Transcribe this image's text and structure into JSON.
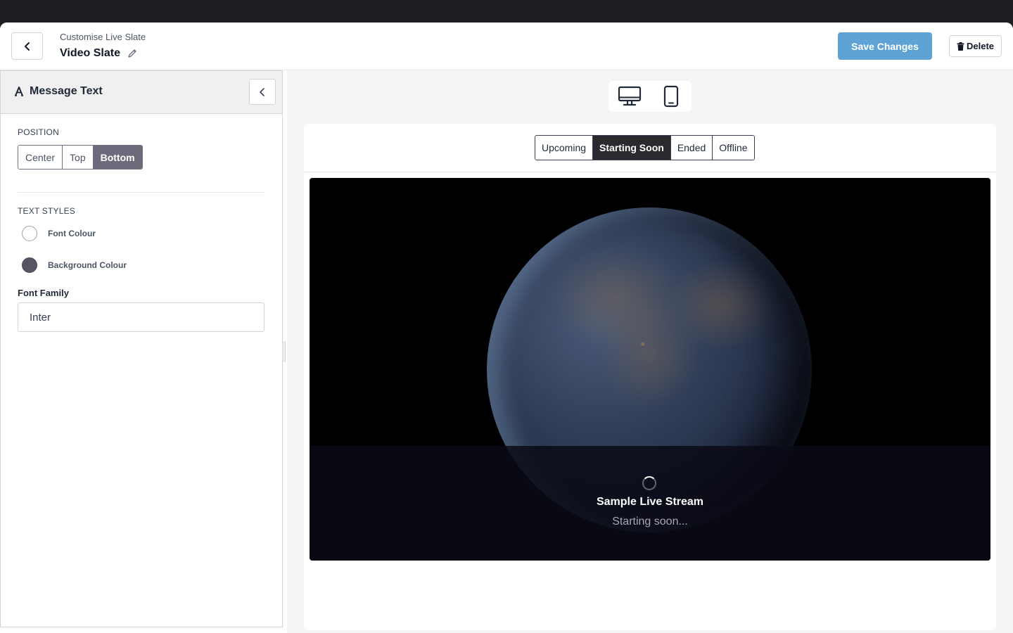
{
  "header": {
    "subtitle": "Customise Live Slate",
    "title": "Video Slate",
    "save_label": "Save Changes",
    "delete_label": "Delete"
  },
  "sidebar": {
    "section_title": "Message Text",
    "position_label": "POSITION",
    "position_options": [
      "Center",
      "Top",
      "Bottom"
    ],
    "position_selected": "Bottom",
    "text_styles_label": "TEXT STYLES",
    "font_colour_label": "Font Colour",
    "font_colour_value": "#ffffff",
    "background_colour_label": "Background Colour",
    "background_colour_value": "#555566",
    "font_family_label": "Font Family",
    "font_family_value": "Inter"
  },
  "preview": {
    "device_options": [
      "desktop-icon",
      "mobile-icon"
    ],
    "state_tabs": [
      "Upcoming",
      "Starting Soon",
      "Ended",
      "Offline"
    ],
    "state_selected": "Starting Soon",
    "stream_title": "Sample Live Stream",
    "stream_status": "Starting soon..."
  },
  "colors": {
    "accent": "#5fa3d6",
    "segment_active": "#6b6b7b",
    "tab_active": "#2b2b2f"
  }
}
